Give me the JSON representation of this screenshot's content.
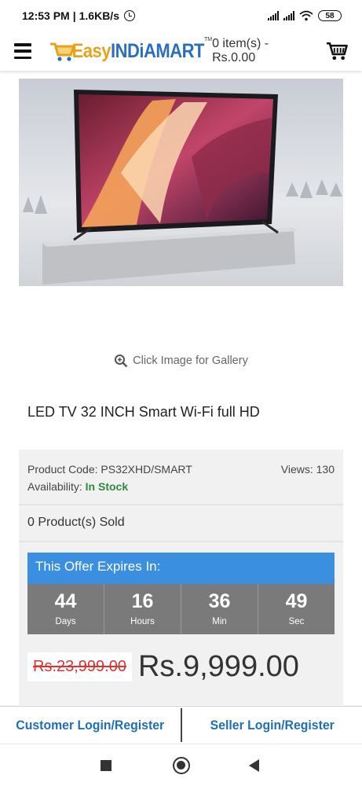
{
  "status_bar": {
    "time": "12:53 PM",
    "net_speed": "1.6KB/s",
    "battery": "58",
    "icons": [
      "alarm-icon",
      "signal-icon",
      "signal-icon",
      "wifi-icon",
      "battery-icon"
    ]
  },
  "header": {
    "logo_easy": "Easy",
    "logo_india": "INDiAMART",
    "logo_tm": "TM",
    "cart_summary": "0 item(s) - Rs.0.00",
    "icons": [
      "menu-icon",
      "cart-icon"
    ]
  },
  "gallery": {
    "label": "Click Image for Gallery",
    "icon": "zoom-in-icon"
  },
  "product": {
    "title": "LED TV 32 INCH Smart Wi-Fi full HD",
    "code_label": "Product Code:",
    "code": "PS32XHD/SMART",
    "views_label": "Views:",
    "views": "130",
    "availability_label": "Availability:",
    "availability": "In Stock",
    "sold": "0 Product(s) Sold"
  },
  "offer": {
    "heading": "This Offer Expires In:",
    "countdown": [
      {
        "value": "44",
        "label": "Days"
      },
      {
        "value": "16",
        "label": "Hours"
      },
      {
        "value": "36",
        "label": "Min"
      },
      {
        "value": "49",
        "label": "Sec"
      }
    ]
  },
  "price": {
    "old": "Rs.23,999.00",
    "new": "Rs.9,999.00"
  },
  "login_bar": {
    "customer": "Customer Login/Register",
    "seller": "Seller Login/Register"
  },
  "colors": {
    "accent_blue": "#3b8fe0",
    "link_blue": "#1f6fb3",
    "in_stock_green": "#2e8b3c",
    "old_price_red": "#d33333",
    "countdown_gray": "#7a7a7a"
  }
}
